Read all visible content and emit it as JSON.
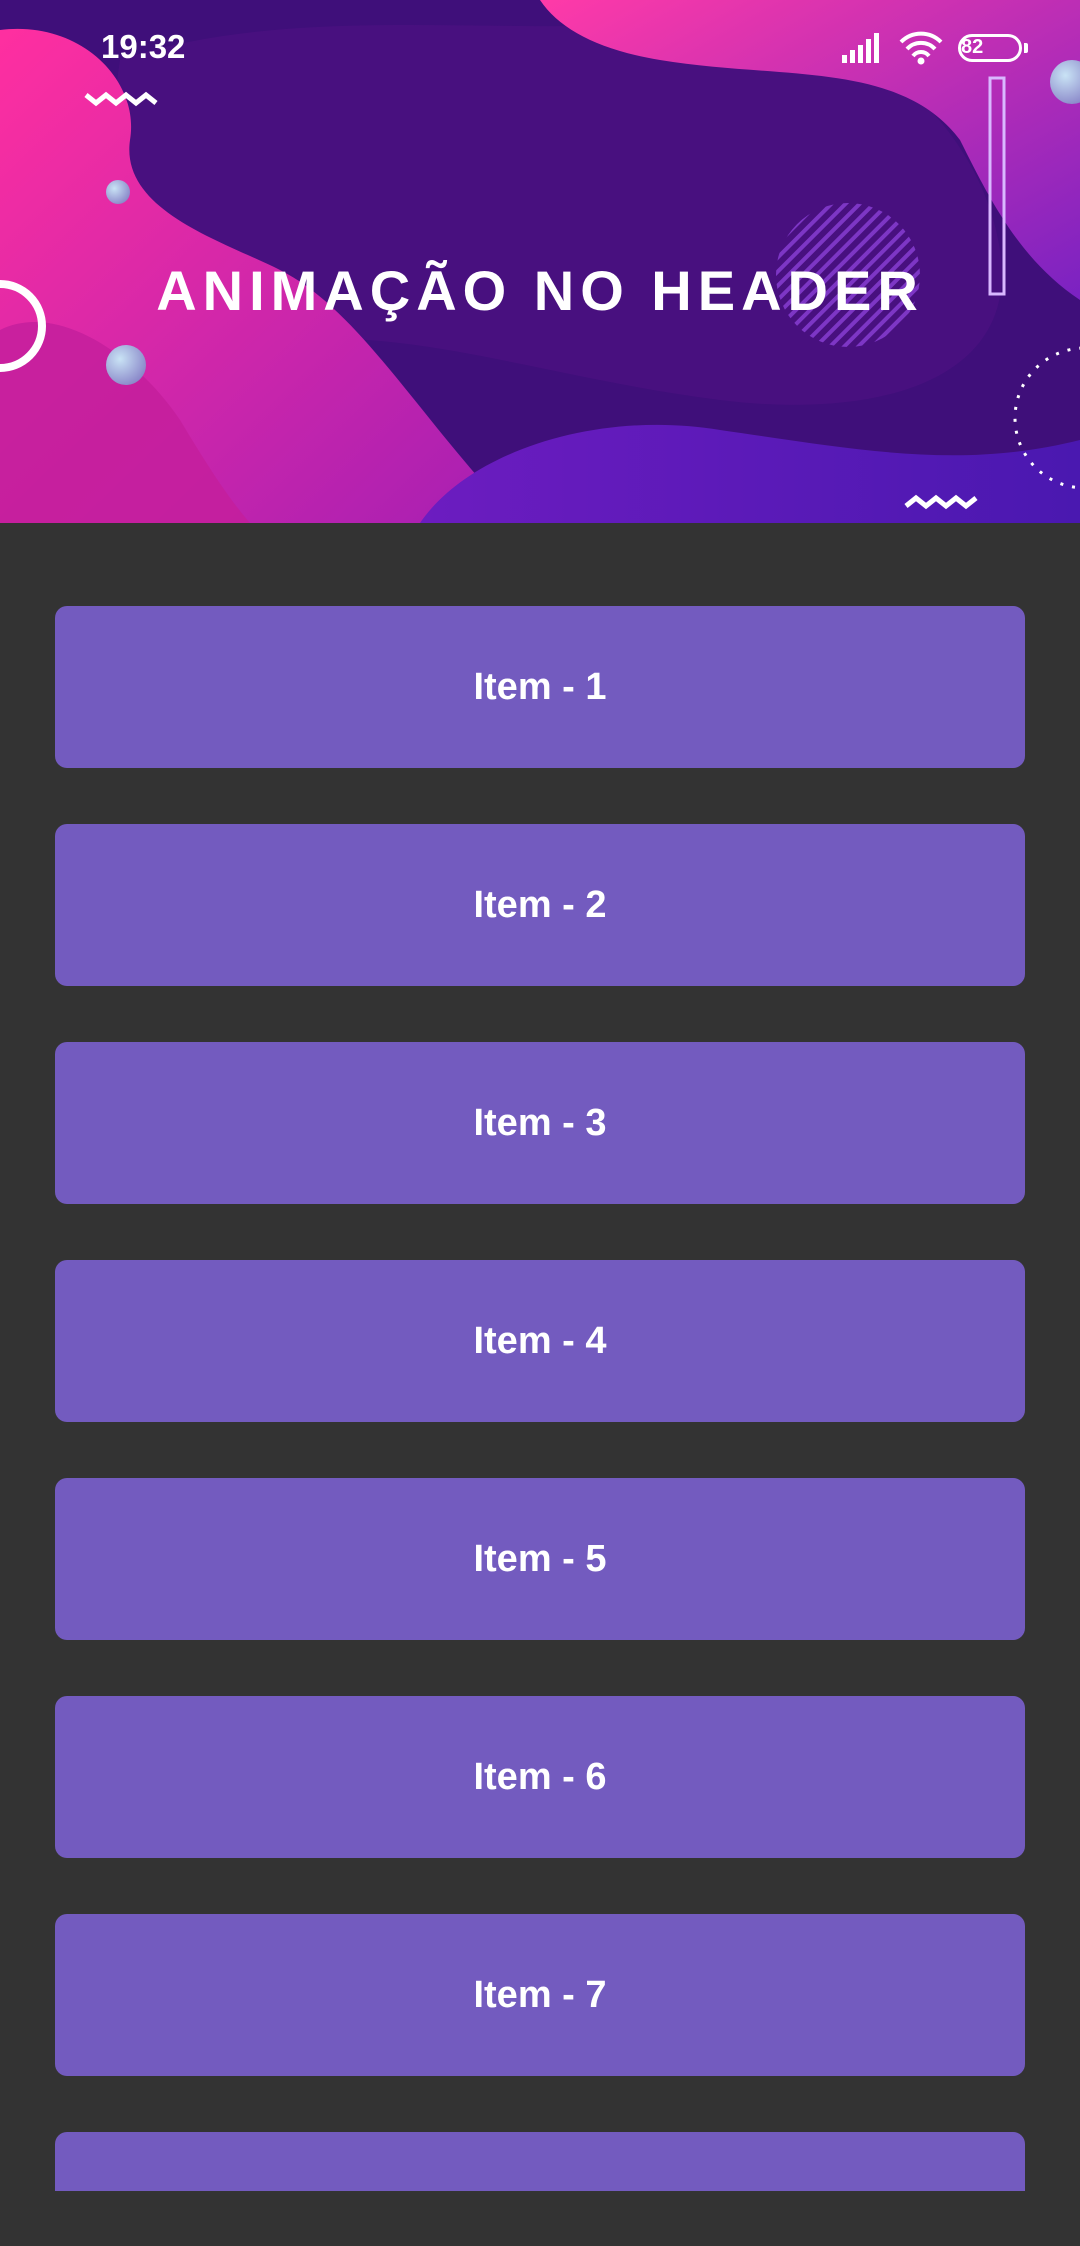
{
  "status_bar": {
    "time": "19:32",
    "battery_level": "82",
    "icons": [
      "signal-icon",
      "wifi-icon",
      "battery-icon"
    ]
  },
  "header": {
    "title": "ANIMAÇÃO NO HEADER",
    "colors": {
      "base": "#3f0f7a",
      "magenta": "#e0279c",
      "violet": "#5a1fb8",
      "deep": "#48107f"
    }
  },
  "list": {
    "items": [
      {
        "label": "Item - 1"
      },
      {
        "label": "Item - 2"
      },
      {
        "label": "Item - 3"
      },
      {
        "label": "Item - 4"
      },
      {
        "label": "Item - 5"
      },
      {
        "label": "Item - 6"
      },
      {
        "label": "Item - 7"
      },
      {
        "label": ""
      }
    ],
    "item_color": "#735bbf",
    "background_color": "#333333"
  }
}
